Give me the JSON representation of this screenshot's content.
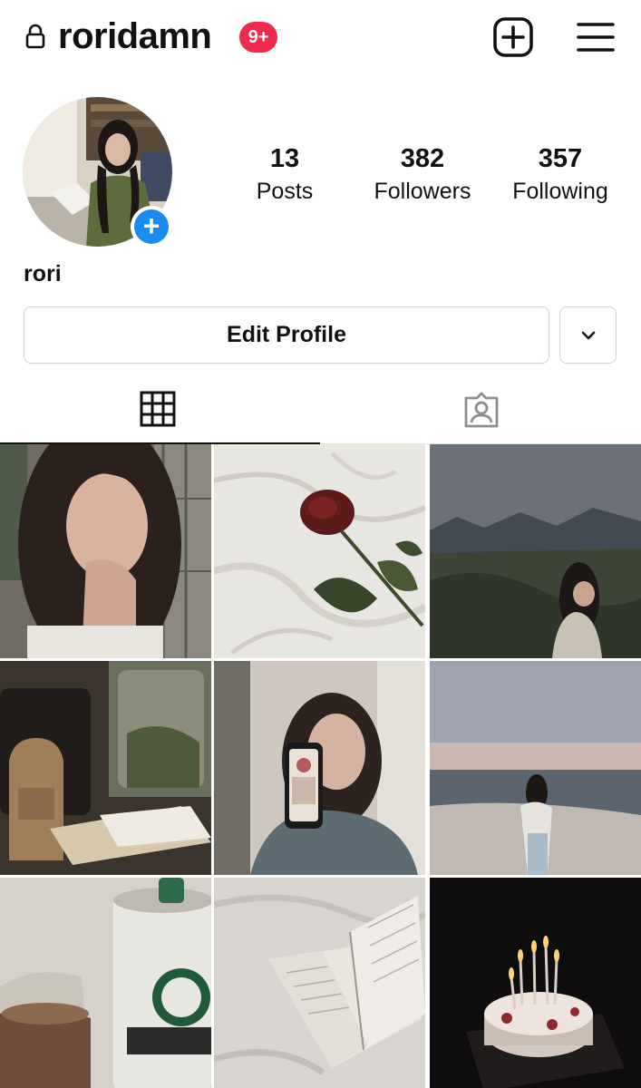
{
  "header": {
    "username": "roridamn",
    "notification_badge": "9+",
    "icons": {
      "lock": "lock-icon",
      "new_post": "plus-square-icon",
      "menu": "hamburger-menu-icon"
    },
    "badge_color": "#ef2a4a"
  },
  "profile": {
    "display_name": "rori",
    "stats": [
      {
        "value": "13",
        "label": "Posts"
      },
      {
        "value": "382",
        "label": "Followers"
      },
      {
        "value": "357",
        "label": "Following"
      }
    ],
    "add_story_color": "#1a8cf0"
  },
  "actions": {
    "edit_profile_label": "Edit Profile",
    "more_icon": "chevron-down-icon"
  },
  "tabs": [
    {
      "name": "posts-grid",
      "icon": "grid-icon",
      "active": true
    },
    {
      "name": "tagged",
      "icon": "tagged-person-icon",
      "active": false
    }
  ],
  "posts": [
    {
      "subject": "selfie-portrait"
    },
    {
      "subject": "red-rose-on-sheets"
    },
    {
      "subject": "mountain-landscape-woman"
    },
    {
      "subject": "train-window-backpack"
    },
    {
      "subject": "mirror-selfie-phone"
    },
    {
      "subject": "beach-sunset-woman"
    },
    {
      "subject": "starbucks-doubleshot-can"
    },
    {
      "subject": "open-book-on-bed"
    },
    {
      "subject": "birthday-cake-candles"
    }
  ]
}
